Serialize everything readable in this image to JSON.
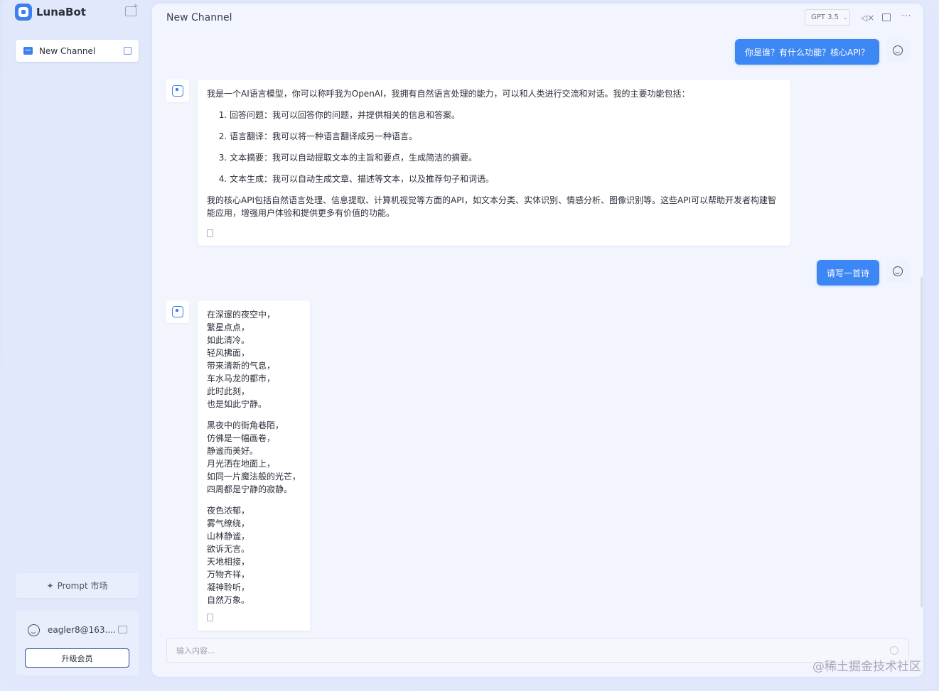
{
  "app": {
    "name": "LunaBot"
  },
  "sidebar": {
    "channels": [
      {
        "label": "New Channel"
      }
    ],
    "prompt_market_label": "Prompt 市场",
    "user": {
      "email": "eagler8@163....",
      "upgrade_label": "升级会员"
    }
  },
  "header": {
    "title": "New Channel",
    "model": "GPT 3.5"
  },
  "messages": [
    {
      "role": "user",
      "text": "你是谁？有什么功能？核心API？"
    },
    {
      "role": "bot",
      "intro": "我是一个AI语言模型，你可以称呼我为OpenAI，我拥有自然语言处理的能力，可以和人类进行交流和对话。我的主要功能包括：",
      "items": [
        "回答问题：我可以回答你的问题，并提供相关的信息和答案。",
        "语言翻译：我可以将一种语言翻译成另一种语言。",
        "文本摘要：我可以自动提取文本的主旨和要点，生成简洁的摘要。",
        "文本生成：我可以自动生成文章、描述等文本，以及推荐句子和词语。"
      ],
      "outro": "我的核心API包括自然语言处理、信息提取、计算机视觉等方面的API，如文本分类、实体识别、情感分析、图像识别等。这些API可以帮助开发者构建智能应用，增强用户体验和提供更多有价值的功能。"
    },
    {
      "role": "user",
      "text": "请写一首诗"
    },
    {
      "role": "bot",
      "stanzas": [
        [
          "在深邃的夜空中，",
          "繁星点点，",
          "如此清冷。",
          "轻风拂面，",
          "带来清新的气息，",
          "车水马龙的都市，",
          "此时此刻，",
          "也是如此宁静。"
        ],
        [
          "黑夜中的街角巷陌，",
          "仿佛是一幅画卷，",
          "静谧而美好。",
          "月光洒在地面上，",
          "如同一片魔法般的光芒，",
          "四周都是宁静的寂静。"
        ],
        [
          "夜色浓郁，",
          "雾气缭绕，",
          "山林静谧，",
          "欲诉无言。",
          "天地相接，",
          "万物齐祥，",
          "凝神聆听，",
          "自然万象。"
        ]
      ]
    }
  ],
  "input": {
    "placeholder": "输入内容..."
  },
  "watermark": "@稀土掘金技术社区"
}
